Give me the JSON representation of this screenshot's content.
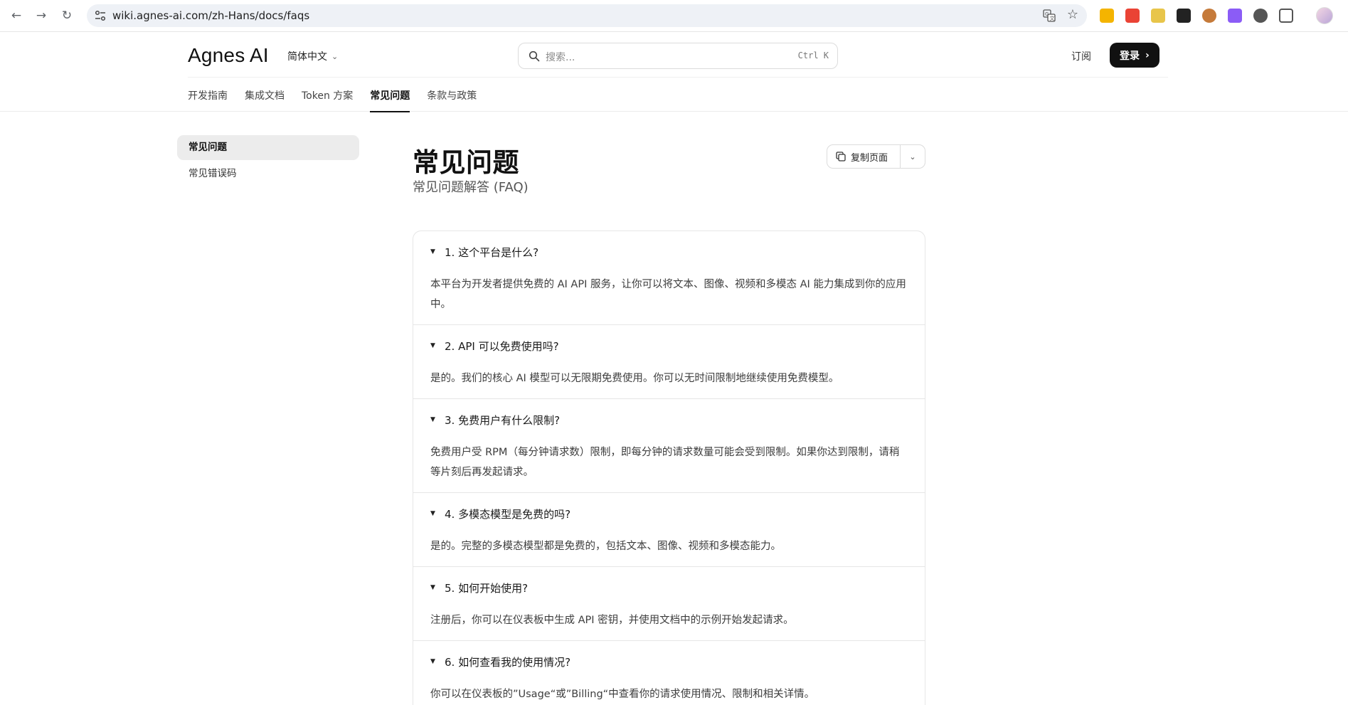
{
  "browser": {
    "url": "wiki.agnes-ai.com/zh-Hans/docs/faqs"
  },
  "header": {
    "logo": "Agnes AI",
    "language": "简体中文",
    "search_placeholder": "搜索...",
    "search_shortcut": "Ctrl K",
    "subscribe": "订阅",
    "login": "登录"
  },
  "tabs": [
    {
      "label": "开发指南"
    },
    {
      "label": "集成文档"
    },
    {
      "label": "Token 方案"
    },
    {
      "label": "常见问题",
      "active": true
    },
    {
      "label": "条款与政策"
    }
  ],
  "sidebar": {
    "items": [
      {
        "label": "常见问题",
        "active": true
      },
      {
        "label": "常见错误码"
      }
    ]
  },
  "main": {
    "title": "常见问题",
    "subtitle": "常见问题解答 (FAQ)",
    "copy_page": "复制页面",
    "faqs": [
      {
        "q": "1. 这个平台是什么?",
        "a": "本平台为开发者提供免费的 AI API 服务，让你可以将文本、图像、视频和多模态 AI 能力集成到你的应用中。"
      },
      {
        "q": "2. API 可以免费使用吗?",
        "a": "是的。我们的核心 AI 模型可以无限期免费使用。你可以无时间限制地继续使用免费模型。"
      },
      {
        "q": "3. 免费用户有什么限制?",
        "a": "免费用户受 RPM（每分钟请求数）限制，即每分钟的请求数量可能会受到限制。如果你达到限制，请稍等片刻后再发起请求。"
      },
      {
        "q": "4. 多模态模型是免费的吗?",
        "a": "是的。完整的多模态模型都是免费的，包括文本、图像、视频和多模态能力。"
      },
      {
        "q": "5. 如何开始使用?",
        "a": "注册后，你可以在仪表板中生成 API 密钥，并使用文档中的示例开始发起请求。"
      },
      {
        "q": "6. 如何查看我的使用情况?",
        "a": "你可以在仪表板的”Usage“或”Billing“中查看你的请求使用情况、限制和相关详情。"
      }
    ]
  },
  "colors": {
    "accent": "#111111",
    "sidebar_active_bg": "#ececec",
    "border": "#e6e6e6"
  }
}
